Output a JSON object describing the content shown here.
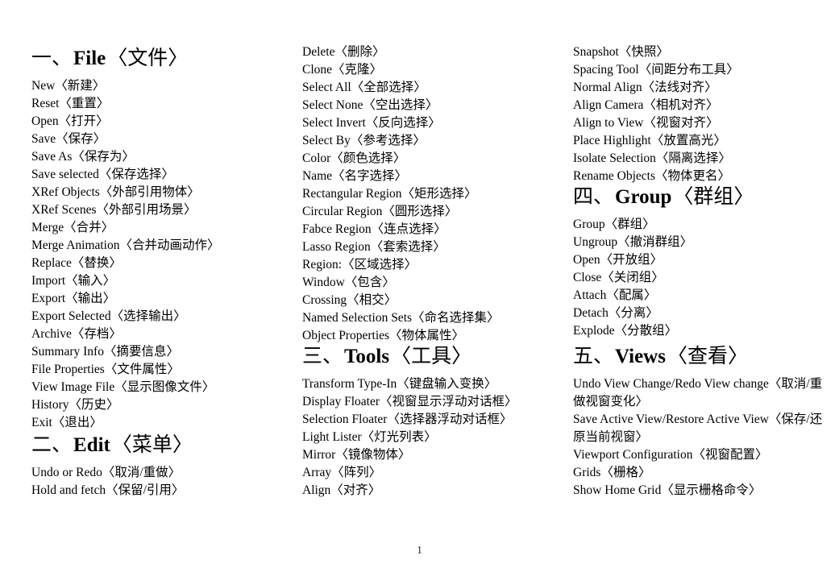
{
  "document": {
    "page_number": "1"
  },
  "sections": [
    {
      "id": "file",
      "number": "一、",
      "english": "File",
      "chinese": "〈文件〉",
      "entries": [
        "New〈新建〉",
        "Reset〈重置〉",
        "Open〈打开〉",
        "Save〈保存〉",
        "Save As〈保存为〉",
        "Save selected〈保存选择〉",
        "XRef Objects〈外部引用物体〉",
        "XRef Scenes〈外部引用场景〉",
        "Merge〈合并〉",
        "Merge Animation〈合并动画动作〉",
        "Replace〈替换〉",
        "Import〈输入〉",
        "Export〈输出〉",
        "Export Selected〈选择输出〉",
        "Archive〈存档〉",
        "Summary Info〈摘要信息〉",
        "File Properties〈文件属性〉",
        "View Image File〈显示图像文件〉",
        "History〈历史〉",
        "Exit〈退出〉"
      ]
    },
    {
      "id": "edit",
      "number": "二、",
      "english": "Edit",
      "chinese": "〈菜单〉",
      "entries": [
        "Undo or Redo〈取消/重做〉",
        "Hold and fetch〈保留/引用〉"
      ],
      "entries_continued": [
        "Delete〈删除〉",
        "Clone〈克隆〉",
        "Select All〈全部选择〉",
        "Select None〈空出选择〉",
        "Select Invert〈反向选择〉",
        "Select By〈参考选择〉",
        "Color〈颜色选择〉",
        "Name〈名字选择〉",
        "Rectangular Region〈矩形选择〉",
        "Circular Region〈圆形选择〉",
        "Fabce Region〈连点选择〉",
        "Lasso Region〈套索选择〉",
        "Region:〈区域选择〉",
        "Window〈包含〉",
        "Crossing〈相交〉",
        "Named Selection Sets〈命名选择集〉",
        "Object Properties〈物体属性〉"
      ]
    },
    {
      "id": "tools",
      "number": "三、",
      "english": "Tools",
      "chinese": "〈工具〉",
      "entries": [
        "Transform Type-In〈键盘输入变换〉",
        "Display Floater〈视窗显示浮动对话框〉",
        "Selection Floater〈选择器浮动对话框〉",
        "Light Lister〈灯光列表〉",
        "Mirror〈镜像物体〉",
        "Array〈阵列〉",
        "Align〈对齐〉"
      ],
      "entries_continued": [
        "Snapshot〈快照〉",
        "Spacing Tool〈间距分布工具〉",
        "Normal Align〈法线对齐〉",
        "Align Camera〈相机对齐〉",
        "Align to View〈视窗对齐〉",
        "Place Highlight〈放置高光〉",
        "Isolate Selection〈隔离选择〉",
        "Rename Objects〈物体更名〉"
      ]
    },
    {
      "id": "group",
      "number": "四、",
      "english": "Group",
      "chinese": "〈群组〉",
      "entries": [
        "Group〈群组〉",
        "Ungroup〈撤消群组〉",
        "Open〈开放组〉",
        "Close〈关闭组〉",
        "Attach〈配属〉",
        "Detach〈分离〉",
        "Explode〈分散组〉"
      ]
    },
    {
      "id": "views",
      "number": "五、",
      "english": "Views",
      "chinese": "〈查看〉",
      "entries": [
        "Undo View Change/Redo View change〈取消/重做视窗变化〉",
        "Save Active View/Restore Active View〈保存/还原当前视窗〉",
        "Viewport Configuration〈视窗配置〉",
        "Grids〈栅格〉",
        "Show Home Grid〈显示栅格命令〉"
      ]
    }
  ]
}
